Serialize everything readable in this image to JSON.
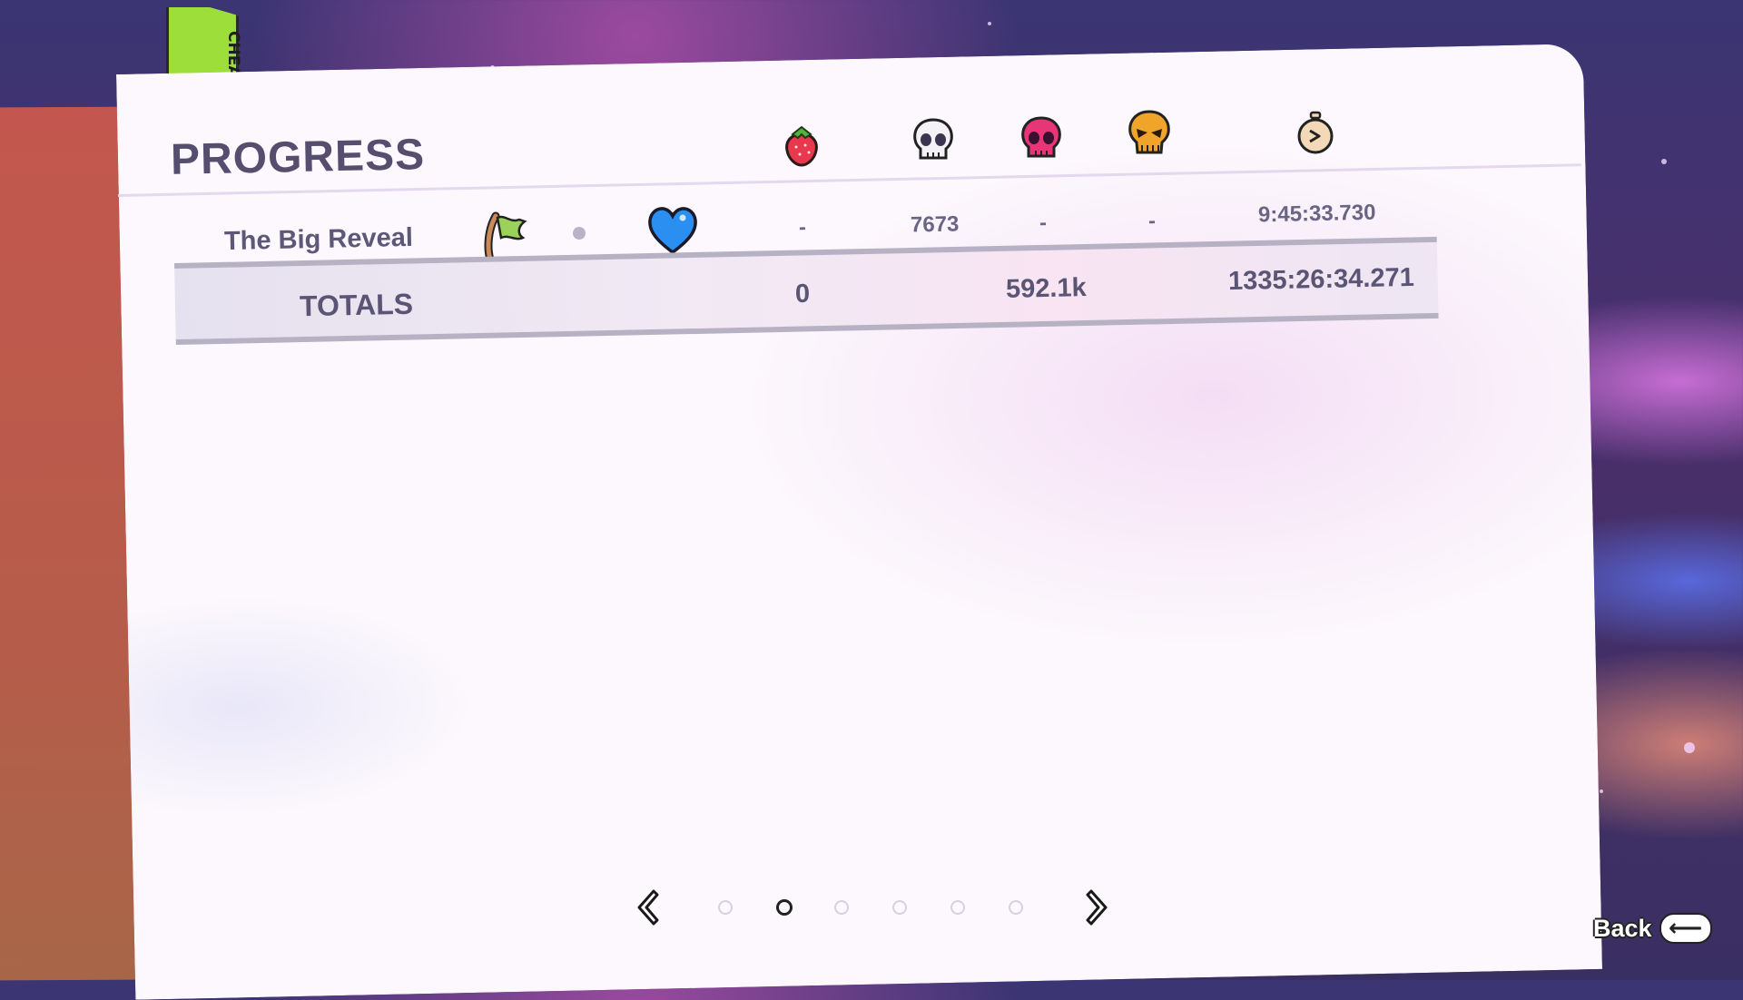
{
  "bookmark": {
    "label": "CHEAT MODE"
  },
  "page": {
    "title": "PROGRESS",
    "columns": [
      {
        "icon": "strawberry-icon"
      },
      {
        "icon": "skull-white-icon"
      },
      {
        "icon": "skull-pink-icon"
      },
      {
        "icon": "skull-gold-icon"
      },
      {
        "icon": "stopwatch-icon"
      }
    ],
    "row": {
      "name": "The Big Reveal",
      "icons": [
        "flag-icon",
        "dot-icon",
        "blue-heart-icon"
      ],
      "strawberries": "-",
      "deaths_a": "7673",
      "deaths_b": "-",
      "deaths_c": "-",
      "time": "9:45:33.730"
    },
    "totals": {
      "label": "TOTALS",
      "strawberries": "0",
      "deaths": "592.1k",
      "time": "1335:26:34.271"
    },
    "pager": {
      "pages": 6,
      "active_index": 1
    }
  },
  "footer": {
    "back_label": "Back",
    "back_key": "⟵"
  },
  "colors": {
    "bookmark": "#9dde3a",
    "heart": "#2a8ff0",
    "skull_pink": "#e83577",
    "skull_gold": "#f0a52a",
    "text": "#5e5878"
  }
}
